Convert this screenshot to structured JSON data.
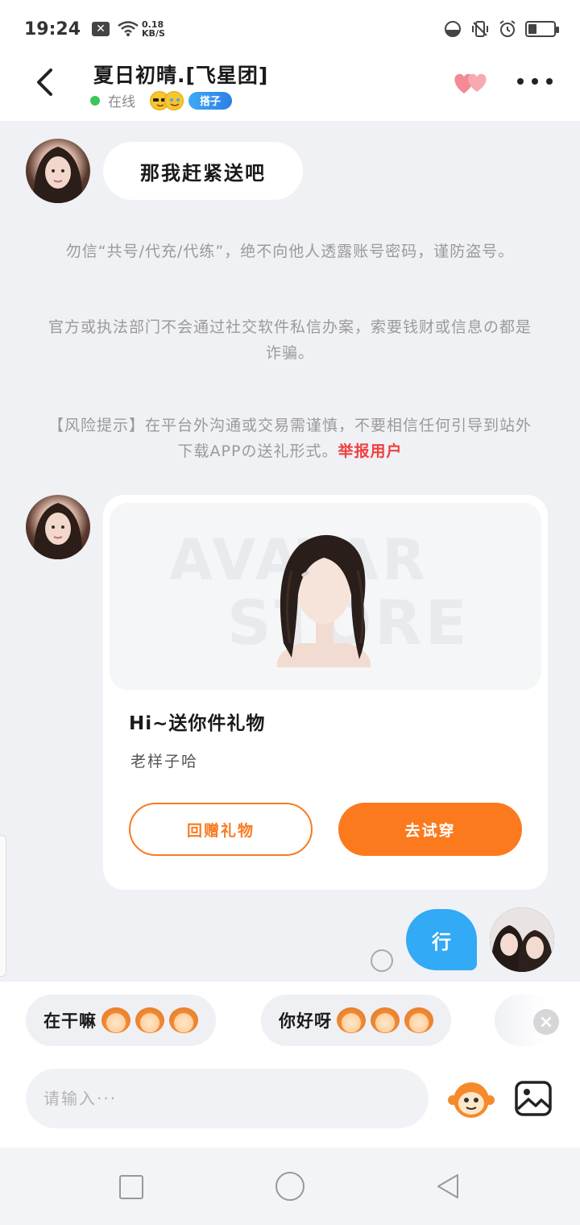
{
  "status_bar": {
    "time": "19:24",
    "net_speed_value": "0.18",
    "net_speed_unit": "KB/S"
  },
  "header": {
    "title": "夏日初晴.[飞星团]",
    "online_status": "在线",
    "tag": "搭子",
    "online_color": "#3cc65a"
  },
  "messages": {
    "incoming_text": "那我赶紧送吧",
    "outgoing_text": "行"
  },
  "notices": {
    "line1": "勿信“共号/代充/代练”，绝不向他人透露账号密码，谨防盗号。",
    "line2": "官方或执法部门不会通过社交软件私信办案，索要钱财或信息の都是诈骗。",
    "line3": "【风险提示】在平台外沟通或交易需谨慎，不要相信任何引导到站外下载APPの送礼形式。",
    "report_link": "举报用户"
  },
  "gift_card": {
    "watermark_top": "AVATAR",
    "watermark_bottom": "STORE",
    "title": "Hi~送你件礼物",
    "subtitle": "老样子哈",
    "return_button": "回赠礼物",
    "try_button": "去试穿",
    "accent_color": "#fb7a1e"
  },
  "quick_replies": [
    {
      "text": "在干嘛"
    },
    {
      "text": "你好呀"
    }
  ],
  "input": {
    "placeholder": "请输入···"
  },
  "icons": {
    "back": "chevron-left-icon",
    "hearts": "double-heart-icon",
    "more": "more-dots-icon",
    "emoji": "monkey-emoji-icon",
    "image": "image-icon"
  }
}
